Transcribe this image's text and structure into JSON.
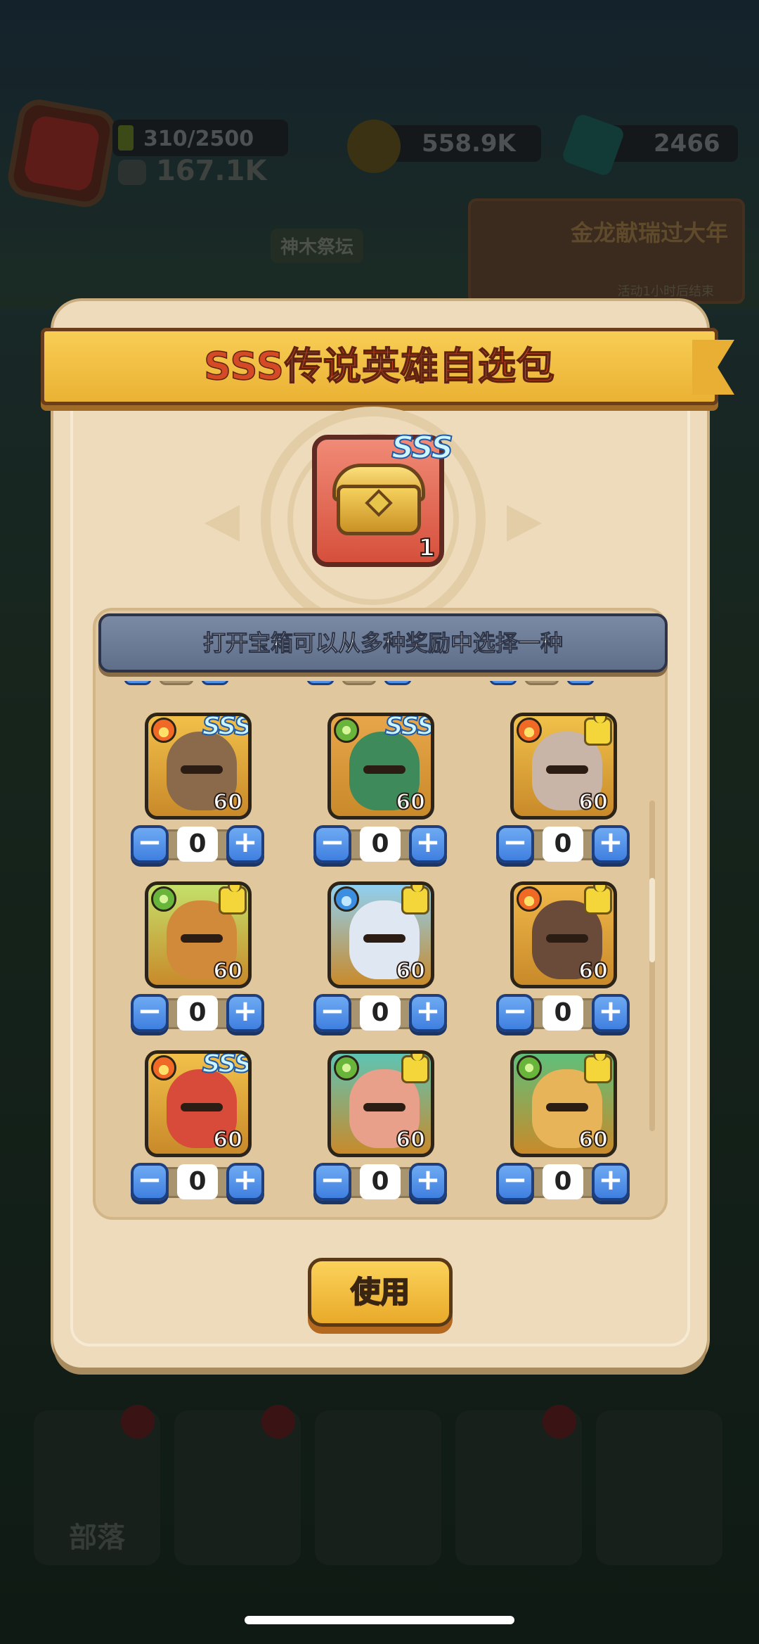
{
  "background": {
    "player": {
      "energy": "310/2500",
      "power": "167.1K"
    },
    "currency": {
      "gold": "558.9K",
      "gems": "2466"
    },
    "event_banner": {
      "title": "金龙献瑞过大年",
      "subtitle": "活动1小时后结束"
    },
    "altar_tag": "神木祭坛",
    "bottom_nav": {
      "tribe_label": "部落"
    }
  },
  "modal": {
    "title": "SSS传说英雄自选包",
    "chest": {
      "grade": "SSS",
      "count": "1",
      "icon": "golden-chest-icon"
    },
    "instruction": "打开宝箱可以从多种奖励中选择一种",
    "heroes": [
      {
        "element": "fire",
        "badge": "SSS",
        "level": "60",
        "quantity": "0",
        "portrait_color": "#f2c04a",
        "face_color": "#8a6a4a"
      },
      {
        "element": "leaf",
        "badge": "SSS",
        "level": "60",
        "quantity": "0",
        "portrait_color": "#e8a64a",
        "face_color": "#3f8a5a"
      },
      {
        "element": "fire",
        "badge": "puzzle",
        "level": "60",
        "quantity": "0",
        "portrait_color": "#f0c14a",
        "face_color": "#c8b5a8"
      },
      {
        "element": "leaf",
        "badge": "puzzle",
        "level": "60",
        "quantity": "0",
        "portrait_color": "#c4e06a",
        "face_color": "#d08a3a"
      },
      {
        "element": "water",
        "badge": "puzzle",
        "level": "60",
        "quantity": "0",
        "portrait_color": "#8fd0f2",
        "face_color": "#dfe8f2"
      },
      {
        "element": "fire",
        "badge": "puzzle",
        "level": "60",
        "quantity": "0",
        "portrait_color": "#f0b84a",
        "face_color": "#6a4a38"
      },
      {
        "element": "fire",
        "badge": "SSS",
        "level": "60",
        "quantity": "0",
        "portrait_color": "#f2c04a",
        "face_color": "#d84a3a"
      },
      {
        "element": "leaf",
        "badge": "puzzle",
        "level": "60",
        "quantity": "0",
        "portrait_color": "#5ec4b4",
        "face_color": "#e8a08a"
      },
      {
        "element": "leaf",
        "badge": "puzzle",
        "level": "60",
        "quantity": "0",
        "portrait_color": "#5fbf7a",
        "face_color": "#e8b45a"
      }
    ],
    "stepper": {
      "minus": "−",
      "plus": "+"
    },
    "use_button": "使用"
  },
  "colors": {
    "ribbon": "#f0bd3e",
    "title_red": "#d44a26",
    "panel": "#e0c79e",
    "button_blue": "#4f8fe8",
    "use_button": "#f2c040"
  }
}
